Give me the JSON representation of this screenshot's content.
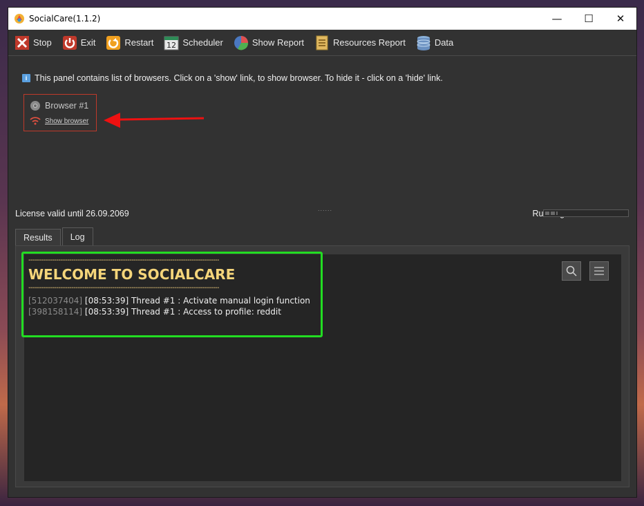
{
  "window": {
    "title": "SocialCare(1.1.2)",
    "minimize": "—",
    "maximize": "☐",
    "close": "✕"
  },
  "toolbar": {
    "items": [
      {
        "label": "Stop",
        "icon": "stop-icon"
      },
      {
        "label": "Exit",
        "icon": "power-icon"
      },
      {
        "label": "Restart",
        "icon": "restart-icon"
      },
      {
        "label": "Scheduler",
        "icon": "calendar-icon",
        "icon_text": "12"
      },
      {
        "label": "Show Report",
        "icon": "pie-chart-icon"
      },
      {
        "label": "Resources Report",
        "icon": "document-icon"
      },
      {
        "label": "Data",
        "icon": "database-icon"
      }
    ]
  },
  "browsers_panel": {
    "info_text": "This panel contains list of browsers. Click on a 'show' link, to show browser. To hide it - click on a 'hide' link.",
    "browser": {
      "name": "Browser #1",
      "link": "Show browser"
    }
  },
  "splitter": "......",
  "status_bar": {
    "license": "License valid until 26.09.2069",
    "status": "Running ...",
    "progress": 0.15
  },
  "tabs": [
    {
      "label": "Results",
      "active": false
    },
    {
      "label": "Log",
      "active": true
    }
  ],
  "log": {
    "separator": "------------------------------------------------------------------------------------------------",
    "heading": "WELCOME TO SOCIALCARE",
    "lines": [
      {
        "id": "[512037404]",
        "text": " [08:53:39] Thread #1 : Activate manual login function"
      },
      {
        "id": "[398158114]",
        "text": " [08:53:39] Thread #1 : Access to profile: reddit"
      }
    ]
  },
  "colors": {
    "accent_red": "#c0392b",
    "highlight_green": "#22dd22",
    "welcome_yellow": "#f5d57a"
  }
}
